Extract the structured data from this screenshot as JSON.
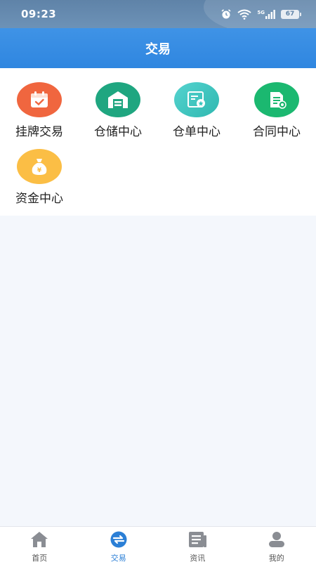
{
  "status": {
    "time": "09:23",
    "network": "5G",
    "battery": "67"
  },
  "header": {
    "title": "交易"
  },
  "grid": {
    "items": [
      {
        "label": "挂牌交易",
        "color": "#f0663f",
        "icon": "calendar-check-icon"
      },
      {
        "label": "仓储中心",
        "color": "#1fa680",
        "icon": "warehouse-icon"
      },
      {
        "label": "仓单中心",
        "color": "#37c6be",
        "icon": "receipt-icon"
      },
      {
        "label": "合同中心",
        "color": "#1bb870",
        "icon": "contract-icon"
      },
      {
        "label": "资金中心",
        "color": "#fbbe45",
        "icon": "money-bag-icon"
      }
    ]
  },
  "tabs": [
    {
      "label": "首页",
      "icon": "home-icon"
    },
    {
      "label": "交易",
      "icon": "exchange-icon",
      "active": true
    },
    {
      "label": "资讯",
      "icon": "news-icon"
    },
    {
      "label": "我的",
      "icon": "user-icon"
    }
  ],
  "colors": {
    "primary": "#2f86e0",
    "active_tab": "#2b7fd6",
    "tab_inactive": "#8a8d93"
  }
}
